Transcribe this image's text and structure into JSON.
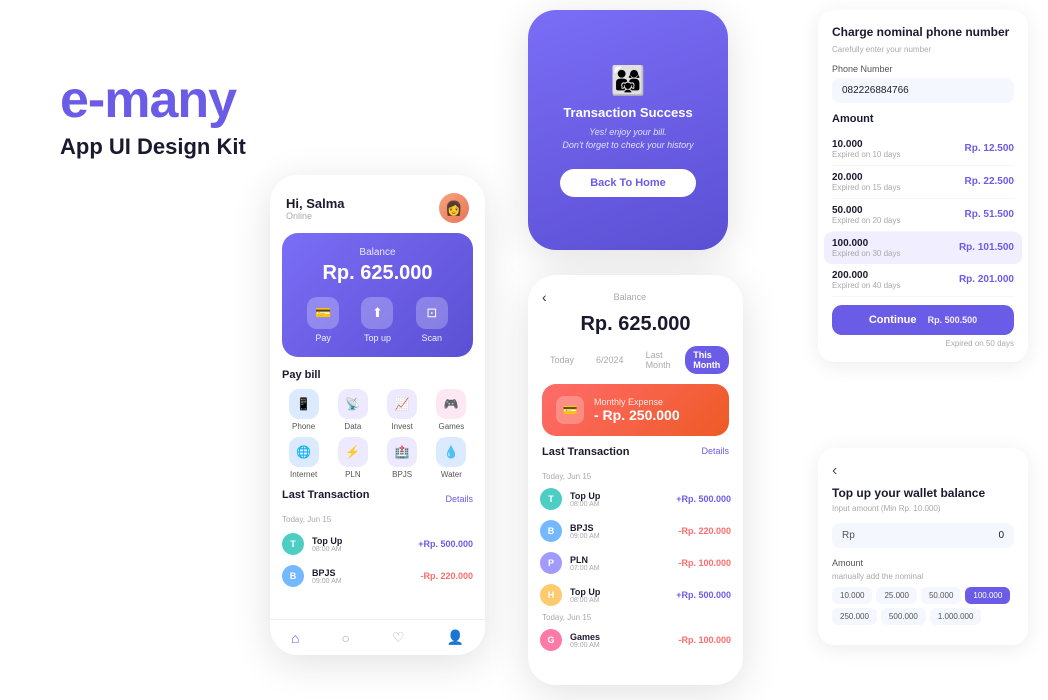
{
  "brand": {
    "name": "e-many",
    "subtitle": "App UI Design Kit"
  },
  "phone1": {
    "greeting": "Hi, Salma",
    "status": "Online",
    "balance_label": "Balance",
    "balance_amount": "Rp. 625.000",
    "actions": [
      {
        "icon": "💳",
        "label": "Pay"
      },
      {
        "icon": "⬆️",
        "label": "Top up"
      },
      {
        "icon": "📷",
        "label": "Scan"
      }
    ],
    "pay_bill_title": "Pay bill",
    "bills": [
      {
        "icon": "📱",
        "label": "Phone",
        "color": "blue"
      },
      {
        "icon": "📡",
        "label": "Data",
        "color": "purple"
      },
      {
        "icon": "📈",
        "label": "Invest",
        "color": "purple"
      },
      {
        "icon": "🎮",
        "label": "Games",
        "color": "pink"
      },
      {
        "icon": "🌐",
        "label": "Internet",
        "color": "blue"
      },
      {
        "icon": "⚡",
        "label": "PLN",
        "color": "purple"
      },
      {
        "icon": "🏥",
        "label": "BPJS",
        "color": "purple"
      },
      {
        "icon": "💧",
        "label": "Water",
        "color": "blue"
      }
    ],
    "last_tx_title": "Last Transaction",
    "details_label": "Details",
    "tx_date": "Today, Jun 15",
    "transactions": [
      {
        "initial": "T",
        "name": "Top Up",
        "time": "08:00 AM",
        "amount": "+Rp. 500.000",
        "type": "plus",
        "color": "teal"
      },
      {
        "initial": "B",
        "name": "BPJS",
        "time": "09:00 AM",
        "amount": "-Rp. 220.000",
        "type": "minus",
        "color": "blue"
      }
    ]
  },
  "phone2": {
    "success_title": "Transaction Success",
    "success_desc_line1": "Yes! enjoy your bill.",
    "success_desc_line2": "Don't forget to check your history",
    "back_home_label": "Back To Home"
  },
  "phone3": {
    "balance_label": "Balance",
    "balance_amount": "Rp. 625.000",
    "tabs": [
      "Today",
      "6/2024",
      "Last Month",
      "This Month"
    ],
    "active_tab": "This Month",
    "expense_label": "Monthly Expense",
    "expense_amount": "- Rp. 250.000",
    "last_tx_title": "Last Transaction",
    "details_label": "Details",
    "tx_date1": "Today, Jun 15",
    "transactions": [
      {
        "initial": "T",
        "name": "Top Up",
        "time": "08:00 AM",
        "amount": "+Rp. 500.000",
        "type": "plus",
        "color": "teal"
      },
      {
        "initial": "B",
        "name": "BPJS",
        "time": "09:00 AM",
        "amount": "-Rp. 220.000",
        "type": "minus",
        "color": "blue"
      },
      {
        "initial": "P",
        "name": "PLN",
        "time": "07:00 AM",
        "amount": "-Rp. 100.000",
        "type": "minus",
        "color": "purple"
      },
      {
        "initial": "H",
        "name": "Top Up",
        "time": "08:00 AM",
        "amount": "+Rp. 500.000",
        "type": "plus",
        "color": "orange"
      }
    ],
    "tx_date2": "Today, Jun 15",
    "transactions2": [
      {
        "initial": "G",
        "name": "Games",
        "time": "09:00 AM",
        "amount": "-Rp. 100.000",
        "type": "minus",
        "color": "pink"
      }
    ]
  },
  "panel_charge": {
    "title": "Charge  nominal phone number",
    "subtitle": "Carefully enter your number",
    "phone_label": "Phone Number",
    "phone_value": "082226884766",
    "amount_section": "Amount",
    "amounts": [
      {
        "value": "10.000",
        "expiry": "Expired on 10 days",
        "price": "Rp. 12.500"
      },
      {
        "value": "20.000",
        "expiry": "Expired on 15 days",
        "price": "Rp. 22.500"
      },
      {
        "value": "50.000",
        "expiry": "Expired on 20 days",
        "price": "Rp. 51.500"
      },
      {
        "value": "100.000",
        "expiry": "Expired on 30 days",
        "price": "Rp. 101.500",
        "selected": true
      },
      {
        "value": "200.000",
        "expiry": "Expired on 40 days",
        "price": "Rp. 201.000"
      }
    ],
    "continue_label": "Continue",
    "continue_price": "Rp. 500.500",
    "continue_expiry": "Expired on 50 days"
  },
  "panel_topup": {
    "back_arrow": "‹",
    "title": "Top  up your wallet balance",
    "subtitle": "Input amount (Min Rp. 10.000)",
    "rp_label": "Rp",
    "rp_value": "0",
    "amount_label": "Amount",
    "amount_hint": "manually add the nominal",
    "chips": [
      "10.000",
      "25.000",
      "50.000",
      "100.000",
      "250.000",
      "500.000",
      "1.000.000"
    ],
    "active_chip": "100.000"
  }
}
